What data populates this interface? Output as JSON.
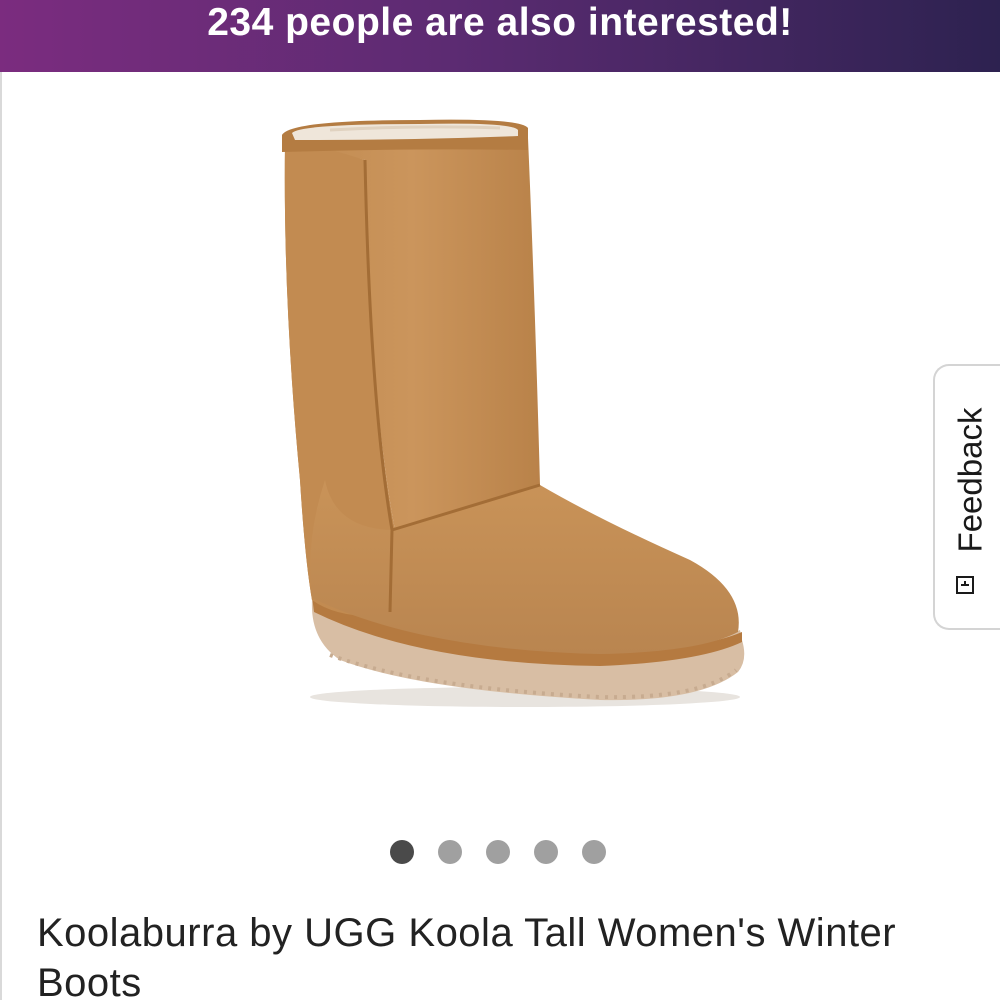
{
  "banner": {
    "text": "234 people are also interested!"
  },
  "feedback": {
    "label": "Feedback"
  },
  "gallery": {
    "total": 5,
    "active": 1
  },
  "product": {
    "title": "Koolaburra by UGG Koola Tall Women's Winter Boots"
  },
  "colors": {
    "banner_start": "#7b2c7f",
    "banner_end": "#2d2250",
    "boot": "#c68f55",
    "sole": "#d8bea4",
    "dot_active": "#4a4a4a",
    "dot_inactive": "#a0a0a0"
  },
  "icons": {
    "feedback": "feedback-icon"
  }
}
